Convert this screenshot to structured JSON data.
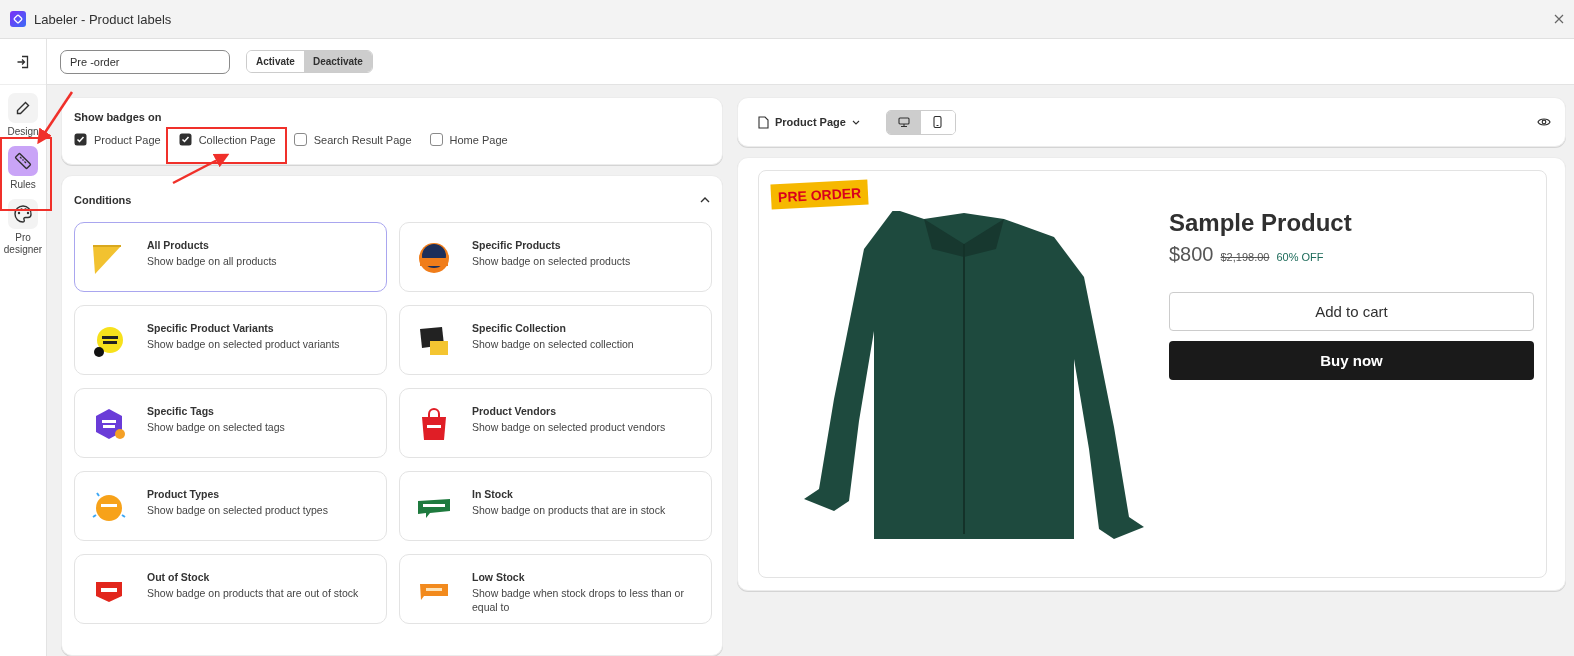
{
  "window": {
    "title": "Labeler - Product labels"
  },
  "rail": {
    "items": [
      {
        "label": "Design",
        "selected": false
      },
      {
        "label": "Rules",
        "selected": true
      },
      {
        "label": "Pro designer",
        "selected": false
      }
    ]
  },
  "top_bar": {
    "label_name": {
      "value": "Pre -order"
    },
    "status_toggle": [
      {
        "label": "Activate",
        "selected": false
      },
      {
        "label": "Deactivate",
        "selected": true
      }
    ]
  },
  "show_badges": {
    "title": "Show badges on",
    "options": [
      {
        "label": "Product Page",
        "checked": true
      },
      {
        "label": "Collection Page",
        "checked": true
      },
      {
        "label": "Search Result Page",
        "checked": false
      },
      {
        "label": "Home Page",
        "checked": false
      }
    ]
  },
  "conditions": {
    "title": "Conditions",
    "expanded": true,
    "items": [
      {
        "title": "All Products",
        "description": "Show badge on all products",
        "selected": true
      },
      {
        "title": "Specific Products",
        "description": "Show badge on selected products",
        "selected": false
      },
      {
        "title": "Specific Product Variants",
        "description": "Show badge on selected product variants",
        "selected": false
      },
      {
        "title": "Specific Collection",
        "description": "Show badge on selected collection",
        "selected": false
      },
      {
        "title": "Specific Tags",
        "description": "Show badge on selected tags",
        "selected": false
      },
      {
        "title": "Product Vendors",
        "description": "Show badge on selected product vendors",
        "selected": false
      },
      {
        "title": "Product Types",
        "description": "Show badge on selected product types",
        "selected": false
      },
      {
        "title": "In Stock",
        "description": "Show badge on products that are in stock",
        "selected": false
      },
      {
        "title": "Out of Stock",
        "description": "Show badge on products that are out of stock",
        "selected": false
      },
      {
        "title": "Low Stock",
        "description": "Show badge when stock drops to less than or equal to",
        "selected": false
      }
    ]
  },
  "preview": {
    "page_select": "Product Page",
    "devices": [
      {
        "selected": true
      },
      {
        "selected": false
      }
    ],
    "product": {
      "badge": "PRE ORDER",
      "name": "Sample Product",
      "price": "$800",
      "compare_price": "$2,198.00",
      "discount": "60% OFF",
      "buttons": [
        "Add to cart",
        "Buy now"
      ]
    }
  }
}
